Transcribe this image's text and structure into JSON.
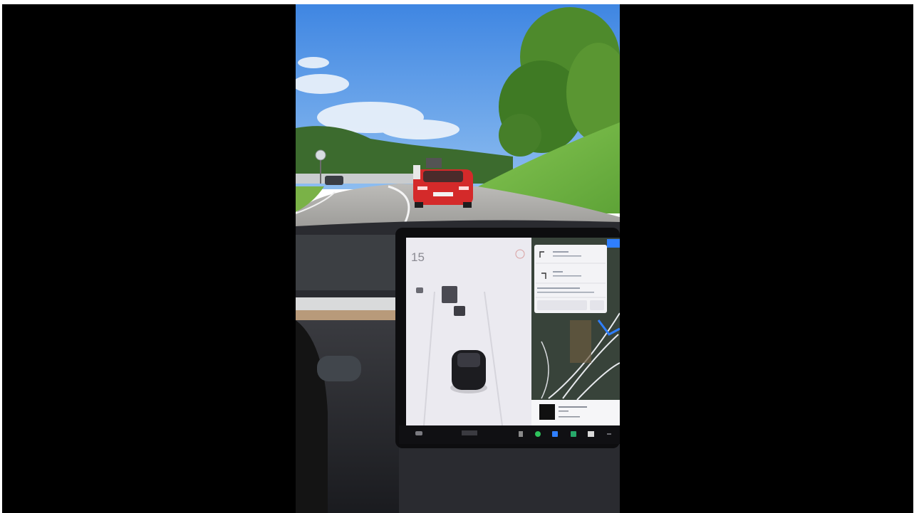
{
  "photo": {
    "description_note": "",
    "speed": {
      "value": "15"
    },
    "tesla_screen": {
      "map_icon": "map-icon",
      "nav_card_icons": [
        "turn-left-icon",
        "turn-right-icon"
      ],
      "dock_icons": [
        "car-icon",
        "phone-icon",
        "bluetooth-icon",
        "app-icon",
        "media-icon"
      ]
    },
    "colors": {
      "sky": "#4a8fe0",
      "grass": "#7cc04a",
      "road": "#b0afae",
      "red_car": "#d42a2a",
      "screen_bg": "#ebeaf0",
      "map_bg": "#38433a"
    }
  }
}
